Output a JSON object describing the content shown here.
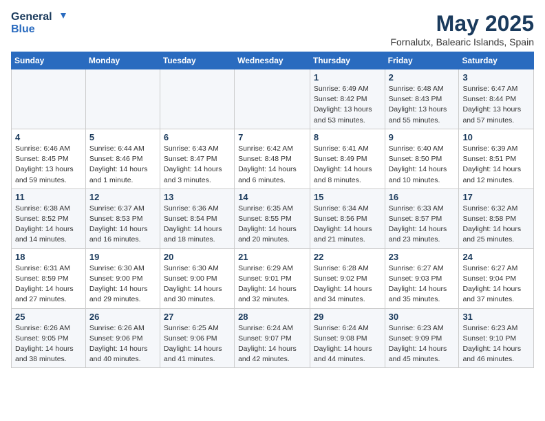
{
  "logo": {
    "line1": "General",
    "line2": "Blue"
  },
  "title": "May 2025",
  "location": "Fornalutx, Balearic Islands, Spain",
  "days_of_week": [
    "Sunday",
    "Monday",
    "Tuesday",
    "Wednesday",
    "Thursday",
    "Friday",
    "Saturday"
  ],
  "weeks": [
    [
      {
        "day": "",
        "info": ""
      },
      {
        "day": "",
        "info": ""
      },
      {
        "day": "",
        "info": ""
      },
      {
        "day": "",
        "info": ""
      },
      {
        "day": "1",
        "info": "Sunrise: 6:49 AM\nSunset: 8:42 PM\nDaylight: 13 hours\nand 53 minutes."
      },
      {
        "day": "2",
        "info": "Sunrise: 6:48 AM\nSunset: 8:43 PM\nDaylight: 13 hours\nand 55 minutes."
      },
      {
        "day": "3",
        "info": "Sunrise: 6:47 AM\nSunset: 8:44 PM\nDaylight: 13 hours\nand 57 minutes."
      }
    ],
    [
      {
        "day": "4",
        "info": "Sunrise: 6:46 AM\nSunset: 8:45 PM\nDaylight: 13 hours\nand 59 minutes."
      },
      {
        "day": "5",
        "info": "Sunrise: 6:44 AM\nSunset: 8:46 PM\nDaylight: 14 hours\nand 1 minute."
      },
      {
        "day": "6",
        "info": "Sunrise: 6:43 AM\nSunset: 8:47 PM\nDaylight: 14 hours\nand 3 minutes."
      },
      {
        "day": "7",
        "info": "Sunrise: 6:42 AM\nSunset: 8:48 PM\nDaylight: 14 hours\nand 6 minutes."
      },
      {
        "day": "8",
        "info": "Sunrise: 6:41 AM\nSunset: 8:49 PM\nDaylight: 14 hours\nand 8 minutes."
      },
      {
        "day": "9",
        "info": "Sunrise: 6:40 AM\nSunset: 8:50 PM\nDaylight: 14 hours\nand 10 minutes."
      },
      {
        "day": "10",
        "info": "Sunrise: 6:39 AM\nSunset: 8:51 PM\nDaylight: 14 hours\nand 12 minutes."
      }
    ],
    [
      {
        "day": "11",
        "info": "Sunrise: 6:38 AM\nSunset: 8:52 PM\nDaylight: 14 hours\nand 14 minutes."
      },
      {
        "day": "12",
        "info": "Sunrise: 6:37 AM\nSunset: 8:53 PM\nDaylight: 14 hours\nand 16 minutes."
      },
      {
        "day": "13",
        "info": "Sunrise: 6:36 AM\nSunset: 8:54 PM\nDaylight: 14 hours\nand 18 minutes."
      },
      {
        "day": "14",
        "info": "Sunrise: 6:35 AM\nSunset: 8:55 PM\nDaylight: 14 hours\nand 20 minutes."
      },
      {
        "day": "15",
        "info": "Sunrise: 6:34 AM\nSunset: 8:56 PM\nDaylight: 14 hours\nand 21 minutes."
      },
      {
        "day": "16",
        "info": "Sunrise: 6:33 AM\nSunset: 8:57 PM\nDaylight: 14 hours\nand 23 minutes."
      },
      {
        "day": "17",
        "info": "Sunrise: 6:32 AM\nSunset: 8:58 PM\nDaylight: 14 hours\nand 25 minutes."
      }
    ],
    [
      {
        "day": "18",
        "info": "Sunrise: 6:31 AM\nSunset: 8:59 PM\nDaylight: 14 hours\nand 27 minutes."
      },
      {
        "day": "19",
        "info": "Sunrise: 6:30 AM\nSunset: 9:00 PM\nDaylight: 14 hours\nand 29 minutes."
      },
      {
        "day": "20",
        "info": "Sunrise: 6:30 AM\nSunset: 9:00 PM\nDaylight: 14 hours\nand 30 minutes."
      },
      {
        "day": "21",
        "info": "Sunrise: 6:29 AM\nSunset: 9:01 PM\nDaylight: 14 hours\nand 32 minutes."
      },
      {
        "day": "22",
        "info": "Sunrise: 6:28 AM\nSunset: 9:02 PM\nDaylight: 14 hours\nand 34 minutes."
      },
      {
        "day": "23",
        "info": "Sunrise: 6:27 AM\nSunset: 9:03 PM\nDaylight: 14 hours\nand 35 minutes."
      },
      {
        "day": "24",
        "info": "Sunrise: 6:27 AM\nSunset: 9:04 PM\nDaylight: 14 hours\nand 37 minutes."
      }
    ],
    [
      {
        "day": "25",
        "info": "Sunrise: 6:26 AM\nSunset: 9:05 PM\nDaylight: 14 hours\nand 38 minutes."
      },
      {
        "day": "26",
        "info": "Sunrise: 6:26 AM\nSunset: 9:06 PM\nDaylight: 14 hours\nand 40 minutes."
      },
      {
        "day": "27",
        "info": "Sunrise: 6:25 AM\nSunset: 9:06 PM\nDaylight: 14 hours\nand 41 minutes."
      },
      {
        "day": "28",
        "info": "Sunrise: 6:24 AM\nSunset: 9:07 PM\nDaylight: 14 hours\nand 42 minutes."
      },
      {
        "day": "29",
        "info": "Sunrise: 6:24 AM\nSunset: 9:08 PM\nDaylight: 14 hours\nand 44 minutes."
      },
      {
        "day": "30",
        "info": "Sunrise: 6:23 AM\nSunset: 9:09 PM\nDaylight: 14 hours\nand 45 minutes."
      },
      {
        "day": "31",
        "info": "Sunrise: 6:23 AM\nSunset: 9:10 PM\nDaylight: 14 hours\nand 46 minutes."
      }
    ]
  ]
}
